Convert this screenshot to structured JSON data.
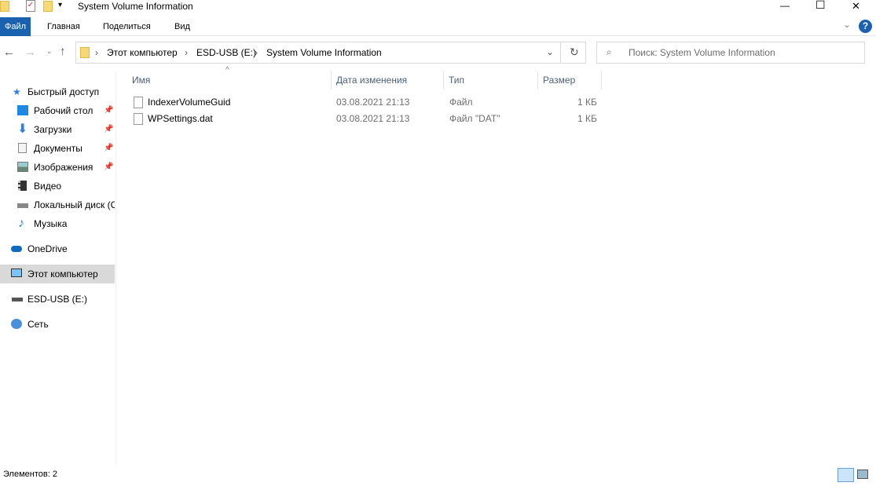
{
  "window": {
    "title": "System Volume Information",
    "minimize": "—",
    "maximize": "☐",
    "close": "✕"
  },
  "ribbon": {
    "tabs": [
      "Файл",
      "Главная",
      "Поделиться",
      "Вид"
    ],
    "help": "?",
    "expand": "⌄"
  },
  "address": {
    "crumbs": [
      "Этот компьютер",
      "ESD-USB (E:)",
      "System Volume Information"
    ]
  },
  "search": {
    "placeholder": "Поиск: System Volume Information"
  },
  "sidebar": {
    "quick_access": "Быстрый доступ",
    "items": [
      "Рабочий стол",
      "Загрузки",
      "Документы",
      "Изображения",
      "Видео",
      "Локальный диск (C:)",
      "Музыка"
    ],
    "onedrive": "OneDrive",
    "this_pc": "Этот компьютер",
    "usb": "ESD-USB (E:)",
    "network": "Сеть"
  },
  "columns": [
    "Имя",
    "Дата изменения",
    "Тип",
    "Размер"
  ],
  "files": [
    {
      "name": "IndexerVolumeGuid",
      "date": "03.08.2021 21:13",
      "type": "Файл",
      "size": "1 КБ"
    },
    {
      "name": "WPSettings.dat",
      "date": "03.08.2021 21:13",
      "type": "Файл \"DAT\"",
      "size": "1 КБ"
    }
  ],
  "status": {
    "count": "Элементов: 2"
  }
}
